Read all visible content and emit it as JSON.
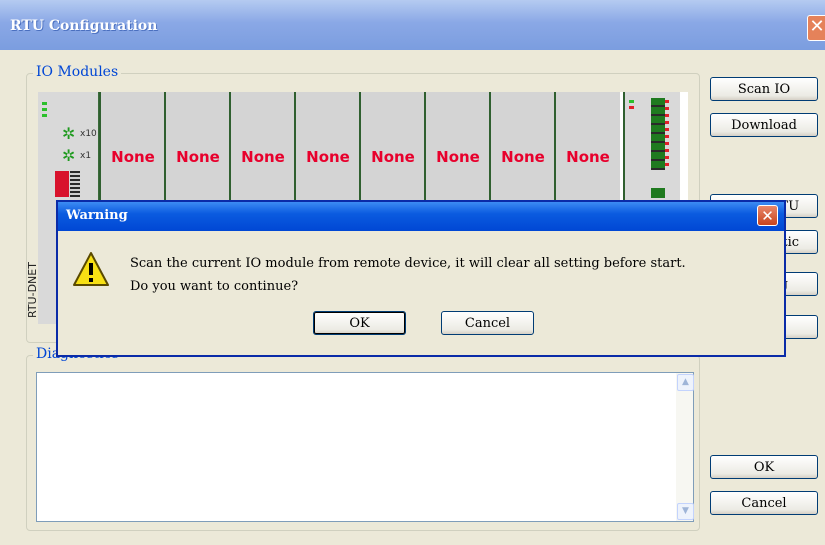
{
  "window": {
    "title": "RTU Configuration",
    "close_glyph": "✕"
  },
  "io_group": {
    "label": "IO Modules"
  },
  "rack": {
    "head_label": "RTU-DNET",
    "slots": [
      "None",
      "None",
      "None",
      "None",
      "None",
      "None",
      "None",
      "None"
    ]
  },
  "diag_group": {
    "label": "Diagnostics"
  },
  "buttons": {
    "scan_io": "Scan IO",
    "download": "Download",
    "hidden_1": "Reset RTU",
    "hidden_2": "Diagnostic",
    "hidden_3": "Setting",
    "ok": "OK",
    "cancel": "Cancel"
  },
  "warning": {
    "title": "Warning",
    "close_glyph": "✕",
    "line1": "Scan the current IO module from remote device, it will clear all setting before start.",
    "line2": "Do you want to continue?",
    "ok": "OK",
    "cancel": "Cancel",
    "icon": "warning-icon"
  },
  "colors": {
    "module_label": "#e8002c",
    "title_blue": "#0047d4",
    "group_label": "#0046d5"
  }
}
